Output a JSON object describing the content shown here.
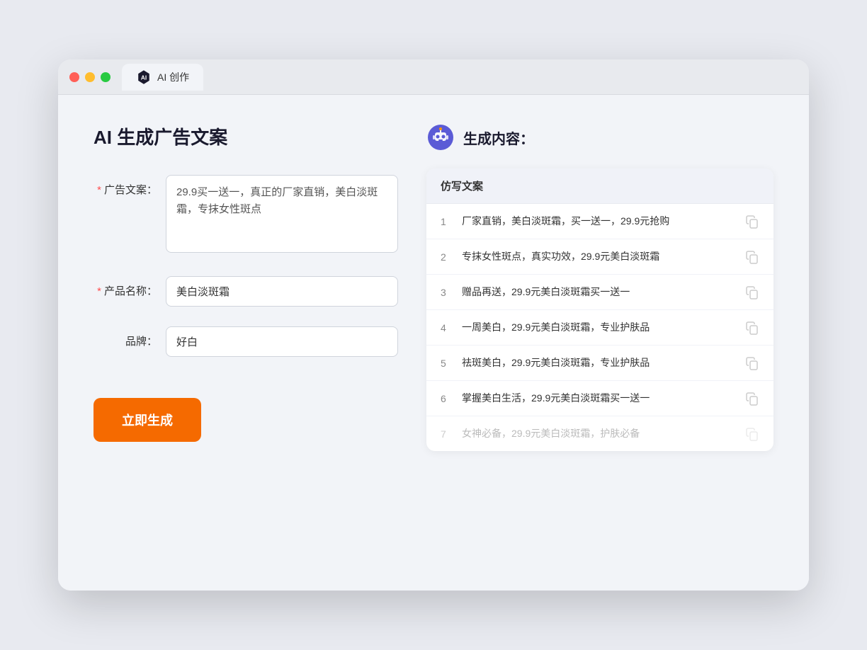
{
  "browser": {
    "tab_label": "AI 创作"
  },
  "page": {
    "title": "AI 生成广告文案",
    "result_title": "生成内容："
  },
  "form": {
    "ad_copy_label": "广告文案：",
    "ad_copy_required": "*",
    "ad_copy_value": "29.9买一送一，真正的厂家直销，美白淡斑霜，专抹女性斑点",
    "product_name_label": "产品名称：",
    "product_name_required": "*",
    "product_name_value": "美白淡斑霜",
    "brand_label": "品牌：",
    "brand_value": "好白",
    "submit_label": "立即生成"
  },
  "table": {
    "header": "仿写文案",
    "rows": [
      {
        "num": "1",
        "text": "厂家直销，美白淡斑霜，买一送一，29.9元抢购",
        "faded": false
      },
      {
        "num": "2",
        "text": "专抹女性斑点，真实功效，29.9元美白淡斑霜",
        "faded": false
      },
      {
        "num": "3",
        "text": "赠品再送，29.9元美白淡斑霜买一送一",
        "faded": false
      },
      {
        "num": "4",
        "text": "一周美白，29.9元美白淡斑霜，专业护肤品",
        "faded": false
      },
      {
        "num": "5",
        "text": "祛斑美白，29.9元美白淡斑霜，专业护肤品",
        "faded": false
      },
      {
        "num": "6",
        "text": "掌握美白生活，29.9元美白淡斑霜买一送一",
        "faded": false
      },
      {
        "num": "7",
        "text": "女神必备，29.9元美白淡斑霜，护肤必备",
        "faded": true
      }
    ]
  }
}
